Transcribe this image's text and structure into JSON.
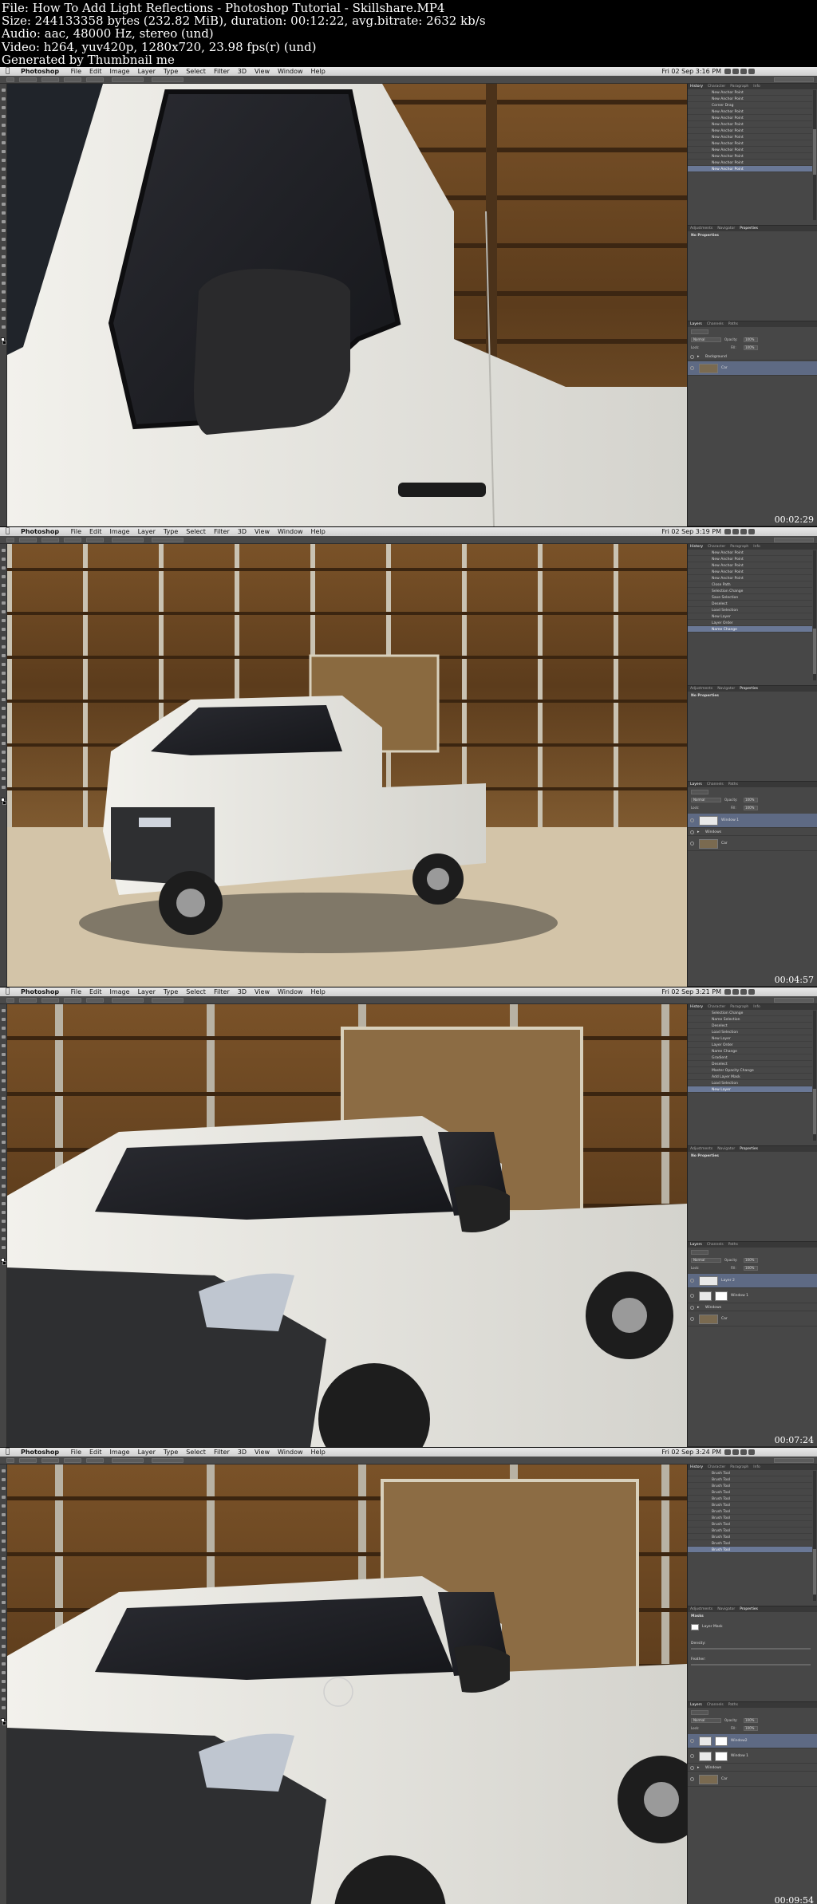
{
  "info": {
    "file": "File: How To Add Light Reflections - Photoshop Tutorial - Skillshare.MP4",
    "size": "Size: 244133358 bytes (232.82 MiB), duration: 00:12:22, avg.bitrate: 2632 kb/s",
    "audio": "Audio: aac, 48000 Hz, stereo (und)",
    "video": "Video: h264, yuv420p, 1280x720, 23.98 fps(r) (und)",
    "generated": "Generated by Thumbnail me"
  },
  "menubar": {
    "app": "Photoshop",
    "items": [
      "File",
      "Edit",
      "Image",
      "Layer",
      "Type",
      "Select",
      "Filter",
      "3D",
      "View",
      "Window",
      "Help"
    ]
  },
  "frames": [
    {
      "clock": "Fri 02 Sep 3:16 PM",
      "timestamp": "00:02:29",
      "history": [
        "New Anchor Point",
        "New Anchor Point",
        "Corner Drag",
        "New Anchor Point",
        "New Anchor Point",
        "New Anchor Point",
        "New Anchor Point",
        "New Anchor Point",
        "New Anchor Point",
        "New Anchor Point",
        "New Anchor Point",
        "New Anchor Point",
        "New Anchor Point"
      ],
      "properties_title": "No Properties",
      "layers": [
        {
          "name": "Background",
          "kind": "group"
        },
        {
          "name": "Car",
          "kind": "layer",
          "selected": true
        }
      ]
    },
    {
      "clock": "Fri 02 Sep 3:19 PM",
      "timestamp": "00:04:57",
      "history": [
        "New Anchor Point",
        "New Anchor Point",
        "New Anchor Point",
        "New Anchor Point",
        "New Anchor Point",
        "Close Path",
        "Selection Change",
        "Save Selection",
        "Deselect",
        "Load Selection",
        "New Layer",
        "Layer Order",
        "Name Change"
      ],
      "properties_title": "No Properties",
      "layers": [
        {
          "name": "Window 1",
          "kind": "layer",
          "selected": true
        },
        {
          "name": "Windows",
          "kind": "group"
        },
        {
          "name": "Car",
          "kind": "layer"
        }
      ]
    },
    {
      "clock": "Fri 02 Sep 3:21 PM",
      "timestamp": "00:07:24",
      "history": [
        "Selection Change",
        "Name Selection",
        "Deselect",
        "Load Selection",
        "New Layer",
        "Layer Order",
        "Name Change",
        "Gradient",
        "Deselect",
        "Master Opacity Change",
        "Add Layer Mask",
        "Load Selection",
        "New Layer"
      ],
      "properties_title": "No Properties",
      "layers": [
        {
          "name": "Layer 2",
          "kind": "layer",
          "selected": true
        },
        {
          "name": "Window 1",
          "kind": "mask"
        },
        {
          "name": "Windows",
          "kind": "group"
        },
        {
          "name": "Car",
          "kind": "layer"
        }
      ]
    },
    {
      "clock": "Fri 02 Sep 3:24 PM",
      "timestamp": "00:09:54",
      "history": [
        "Brush Tool",
        "Brush Tool",
        "Brush Tool",
        "Brush Tool",
        "Brush Tool",
        "Brush Tool",
        "Brush Tool",
        "Brush Tool",
        "Brush Tool",
        "Brush Tool",
        "Brush Tool",
        "Brush Tool",
        "Brush Tool"
      ],
      "properties_title": "Masks",
      "properties_sub": "Layer Mask",
      "props_rows": [
        "Density:",
        "Feather:"
      ],
      "layers": [
        {
          "name": "Window2",
          "kind": "mask",
          "selected": true
        },
        {
          "name": "Window 1",
          "kind": "mask"
        },
        {
          "name": "Windows",
          "kind": "group"
        },
        {
          "name": "Car",
          "kind": "layer"
        }
      ]
    }
  ],
  "panel_tabs": {
    "history": [
      "History",
      "Character",
      "Paragraph",
      "Info"
    ],
    "props": [
      "Adjustments",
      "Navigator",
      "Properties"
    ],
    "layers": [
      "Layers",
      "Channels",
      "Paths"
    ]
  },
  "layer_controls": {
    "mode": "Normal",
    "opacity_label": "Opacity:",
    "opacity": "100%",
    "lock_label": "Lock:",
    "fill_label": "Fill:",
    "fill": "100%"
  },
  "colors": {
    "ui_bg": "#3c3c3c",
    "panel_bg": "#474747",
    "selection": "#6a7896",
    "truck_white": "#e8e7e2",
    "window_dark": "#1c1d22",
    "crate_brown": "#6e4a25",
    "pavement": "#d3c4a8"
  }
}
